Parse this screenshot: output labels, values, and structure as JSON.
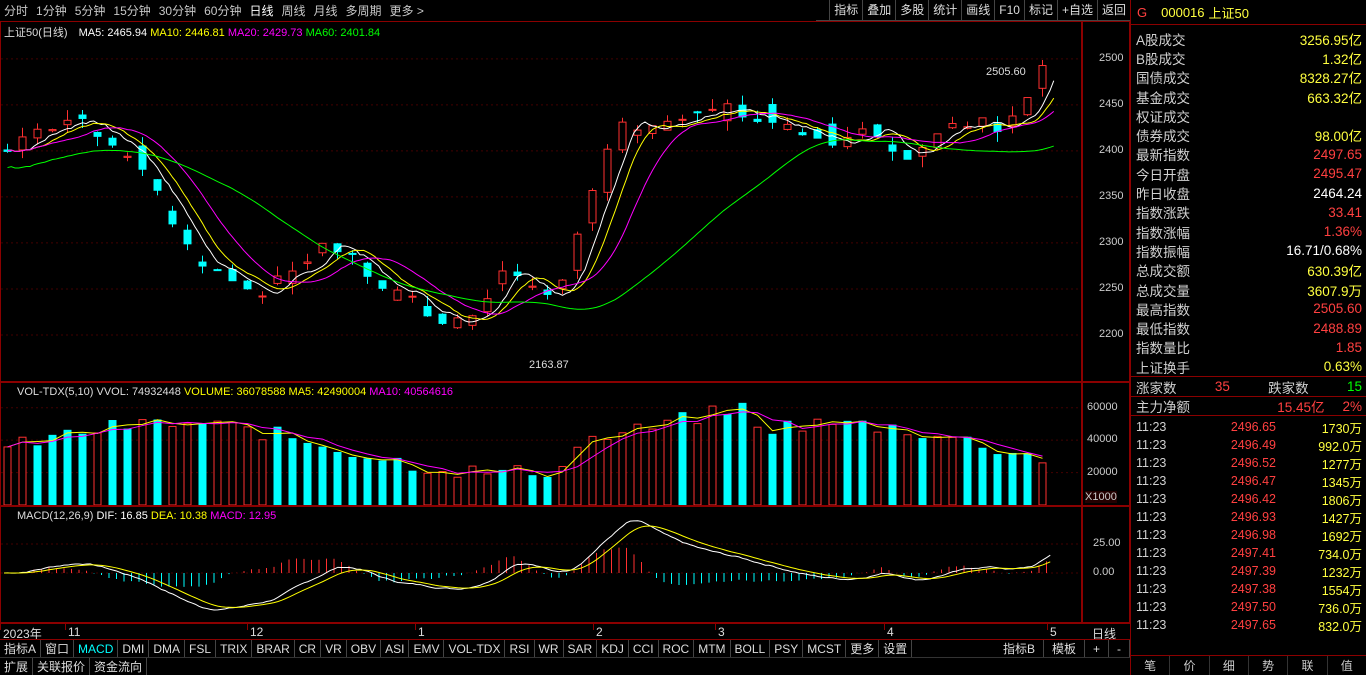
{
  "period_tabs": [
    "分时",
    "1分钟",
    "5分钟",
    "15分钟",
    "30分钟",
    "60分钟",
    "日线",
    "周线",
    "月线",
    "多周期",
    "更多 >"
  ],
  "toolbar": [
    "指标",
    "叠加",
    "多股",
    "统计",
    "画线",
    "F10",
    "标记",
    "+自选",
    "返回"
  ],
  "main_legend": {
    "title": "上证50(日线)",
    "ma5": "MA5: 2465.94",
    "ma10": "MA10: 2446.81",
    "ma20": "MA20: 2429.73",
    "ma60": "MA60: 2401.84"
  },
  "annotations": {
    "high": "2505.60",
    "low": "2163.87"
  },
  "vol_legend": {
    "title": "VOL-TDX(5,10)",
    "vvol": "VVOL: 74932448",
    "volume": "VOLUME: 36078588",
    "ma5": "MA5: 42490004",
    "ma10": "MA10: 40564616"
  },
  "vol_unit": "X1000",
  "macd_legend": {
    "title": "MACD(12,26,9)",
    "dif": "DIF: 16.85",
    "dea": "DEA: 10.38",
    "macd": "MACD: 12.95"
  },
  "date_labels": [
    "2023年",
    "11",
    "12",
    "1",
    "2",
    "3",
    "4",
    "5"
  ],
  "date_axis_label": "日线",
  "indicator_tabs": [
    "指标A",
    "窗口",
    "MACD",
    "DMI",
    "DMA",
    "FSL",
    "TRIX",
    "BRAR",
    "CR",
    "VR",
    "OBV",
    "ASI",
    "EMV",
    "VOL-TDX",
    "RSI",
    "WR",
    "SAR",
    "KDJ",
    "CCI",
    "ROC",
    "MTM",
    "BOLL",
    "PSY",
    "MCST",
    "更多",
    "设置"
  ],
  "indicator_tabs_right": [
    "指标B",
    "模板",
    "+",
    "-"
  ],
  "bottom_tabs": [
    "扩展",
    "关联报价",
    "资金流向"
  ],
  "colors": {
    "up": "#ff3030",
    "down": "#00ffff",
    "ma5": "#ffffff",
    "ma10": "#ffff00",
    "ma20": "#ff00ff",
    "ma60": "#00ff00",
    "frame": "#8b0000"
  },
  "chart_data": [
    {
      "type": "candlestick",
      "title": "上证50(日线)",
      "ylim": [
        2150,
        2540
      ],
      "yticks": [
        2200,
        2250,
        2300,
        2350,
        2400,
        2450,
        2500
      ],
      "ma_values": {
        "MA5": 2465.94,
        "MA10": 2446.81,
        "MA20": 2429.73,
        "MA60": 2401.84
      },
      "high": 2505.6,
      "low": 2163.87,
      "x_months": [
        "2023年",
        "11",
        "12",
        "1",
        "2",
        "3",
        "4",
        "5"
      ]
    },
    {
      "type": "bar",
      "title": "VOL-TDX(5,10)",
      "ylim": [
        0,
        70000
      ],
      "yticks": [
        20000,
        40000,
        60000
      ],
      "unit": "X1000",
      "values": {
        "VVOL": 74932448,
        "VOLUME": 36078588,
        "MA5": 42490004,
        "MA10": 40564616
      }
    },
    {
      "type": "bar",
      "title": "MACD(12,26,9)",
      "yticks": [
        0.0,
        25.0
      ],
      "values": {
        "DIF": 16.85,
        "DEA": 10.38,
        "MACD": 12.95
      }
    }
  ],
  "quote": {
    "code": "000016",
    "name": "上证50",
    "flag": "G",
    "rows": [
      {
        "k": "A股成交",
        "v": "3256.95亿",
        "c": "#ffff40"
      },
      {
        "k": "B股成交",
        "v": "1.32亿",
        "c": "#ffff40"
      },
      {
        "k": "国债成交",
        "v": "8328.27亿",
        "c": "#ffff40"
      },
      {
        "k": "基金成交",
        "v": "663.32亿",
        "c": "#ffff40"
      },
      {
        "k": "权证成交",
        "v": "",
        "c": "#ffff40"
      },
      {
        "k": "债券成交",
        "v": "98.00亿",
        "c": "#ffff40"
      },
      {
        "k": "最新指数",
        "v": "2497.65",
        "c": "#ff4040"
      },
      {
        "k": "今日开盘",
        "v": "2495.47",
        "c": "#ff4040"
      },
      {
        "k": "昨日收盘",
        "v": "2464.24",
        "c": "#ffffff"
      },
      {
        "k": "指数涨跌",
        "v": "33.41",
        "c": "#ff4040"
      },
      {
        "k": "指数涨幅",
        "v": "1.36%",
        "c": "#ff4040"
      },
      {
        "k": "指数振幅",
        "v": "16.71/0.68%",
        "c": "#ffffff"
      },
      {
        "k": "总成交额",
        "v": "630.39亿",
        "c": "#ffff40"
      },
      {
        "k": "总成交量",
        "v": "3607.9万",
        "c": "#ffff40"
      },
      {
        "k": "最高指数",
        "v": "2505.60",
        "c": "#ff4040"
      },
      {
        "k": "最低指数",
        "v": "2488.89",
        "c": "#ff4040"
      },
      {
        "k": "指数量比",
        "v": "1.85",
        "c": "#ff4040"
      },
      {
        "k": "上证换手",
        "v": "0.63%",
        "c": "#ffff40"
      }
    ],
    "updown": {
      "up_label": "涨家数",
      "up": "35",
      "down_label": "跌家数",
      "down": "15"
    },
    "main_net": {
      "label": "主力净额",
      "value": "15.45亿",
      "pct": "2%"
    },
    "ticks": [
      {
        "t": "11:23",
        "p": "2496.65",
        "v": "1730万"
      },
      {
        "t": "11:23",
        "p": "2496.49",
        "v": "992.0万"
      },
      {
        "t": "11:23",
        "p": "2496.52",
        "v": "1277万"
      },
      {
        "t": "11:23",
        "p": "2496.47",
        "v": "1345万"
      },
      {
        "t": "11:23",
        "p": "2496.42",
        "v": "1806万"
      },
      {
        "t": "11:23",
        "p": "2496.93",
        "v": "1427万"
      },
      {
        "t": "11:23",
        "p": "2496.98",
        "v": "1692万"
      },
      {
        "t": "11:23",
        "p": "2497.41",
        "v": "734.0万"
      },
      {
        "t": "11:23",
        "p": "2497.39",
        "v": "1232万"
      },
      {
        "t": "11:23",
        "p": "2497.38",
        "v": "1554万"
      },
      {
        "t": "11:23",
        "p": "2497.50",
        "v": "736.0万"
      },
      {
        "t": "11:23",
        "p": "2497.65",
        "v": "832.0万"
      }
    ],
    "tabs": [
      "笔",
      "价",
      "细",
      "势",
      "联",
      "值"
    ]
  }
}
